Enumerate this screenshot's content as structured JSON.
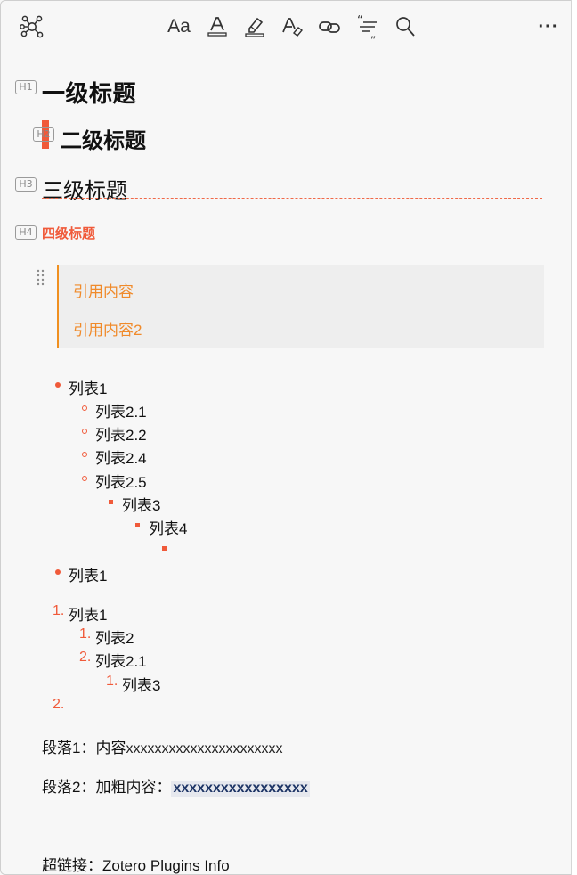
{
  "toolbar": {
    "icons": [
      "graph-icon",
      "font-size-icon",
      "text-color-icon",
      "highlight-icon",
      "clear-format-icon",
      "link-icon",
      "citation-icon",
      "search-icon",
      "more-icon"
    ],
    "font_size_label": "Aa",
    "text_color_label": "A",
    "clear_format_label": "A",
    "more_label": "···"
  },
  "headings": {
    "h1": {
      "badge": "H1",
      "text": "一级标题"
    },
    "h2": {
      "badge": "H2",
      "text": "二级标题"
    },
    "h3": {
      "badge": "H3",
      "text": "三级标题"
    },
    "h4": {
      "badge": "H4",
      "text": "四级标题"
    }
  },
  "blockquote": {
    "lines": [
      "引用内容",
      "引用内容2"
    ]
  },
  "bullet_list": {
    "items": [
      "列表1",
      "列表2.1",
      "列表2.2",
      "列表2.4",
      "列表2.5",
      "列表3",
      "列表4",
      "",
      "列表1"
    ]
  },
  "ordered_list": {
    "items": [
      {
        "num": "1.",
        "text": "列表1"
      },
      {
        "num": "1.",
        "text": "列表2"
      },
      {
        "num": "2.",
        "text": "列表2.1"
      },
      {
        "num": "1.",
        "text": "列表3"
      },
      {
        "num": "2.",
        "text": ""
      }
    ]
  },
  "paragraphs": {
    "p1_label": "段落1：内容",
    "p1_value": "xxxxxxxxxxxxxxxxxxxxxx",
    "p2_label": "段落2：加粗内容：",
    "p2_bold": "xxxxxxxxxxxxxxxxx",
    "link_label": "超链接：",
    "link_text": "Zotero Plugins Info"
  },
  "colors": {
    "accent": "#f05a3a",
    "quote": "#f08a2a",
    "bold_bg": "#e6e8ee"
  }
}
